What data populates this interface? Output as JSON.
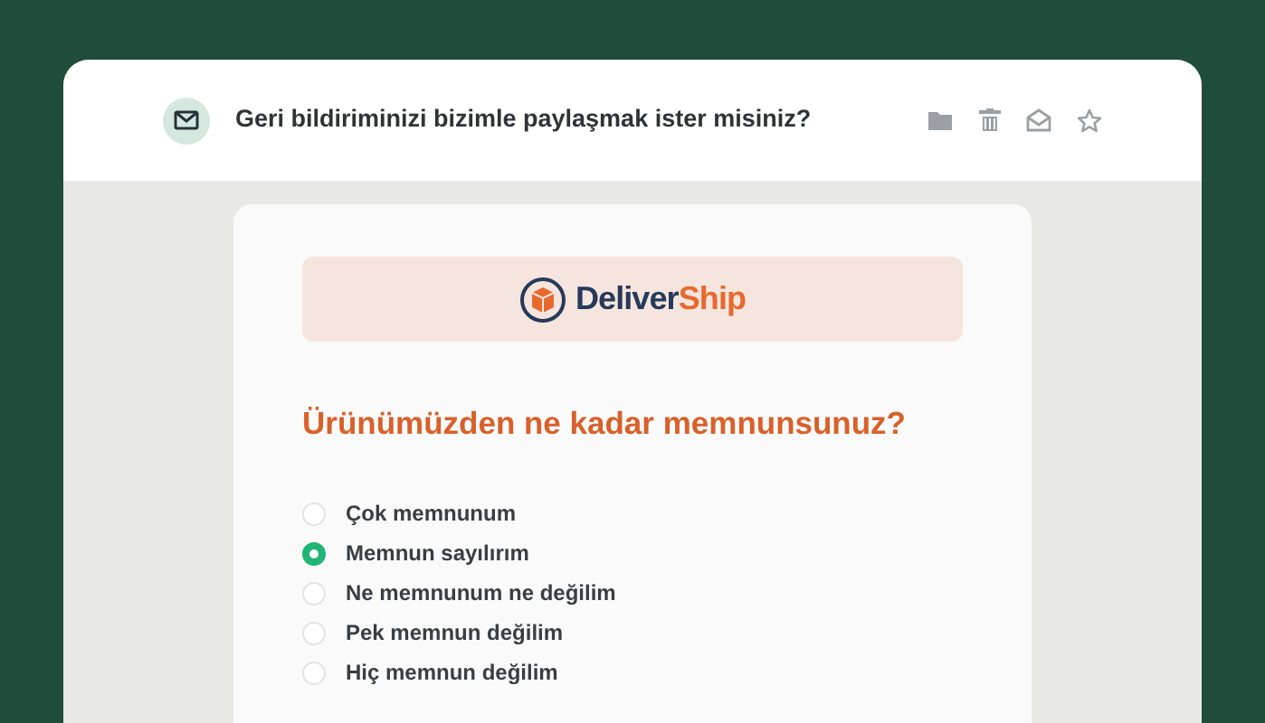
{
  "email": {
    "subject": "Geri bildiriminizi bizimle paylaşmak ister misiniz?"
  },
  "logo": {
    "name_primary": "Deliver",
    "name_accent": "Ship"
  },
  "question": "Ürünümüzden ne kadar memnunsunuz?",
  "options": [
    {
      "label": "Çok memnunum",
      "selected": false
    },
    {
      "label": "Memnun sayılırım",
      "selected": true
    },
    {
      "label": "Ne memnunum ne değilim",
      "selected": false
    },
    {
      "label": "Pek memnun değilim",
      "selected": false
    },
    {
      "label": "Hiç memnun değilim",
      "selected": false
    }
  ]
}
